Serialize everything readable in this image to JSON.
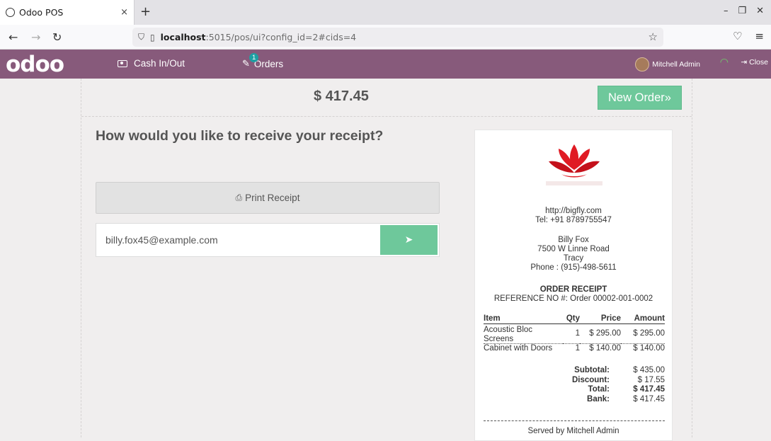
{
  "browser": {
    "tab_title": "Odoo POS",
    "tab_close": "×",
    "new_tab": "+",
    "url_host": "localhost",
    "url_path": ":5015/pos/ui?config_id=2#cids=4"
  },
  "header": {
    "logo": "odoo",
    "cash_label": "Cash In/Out",
    "orders_label": "Orders",
    "orders_badge": "1",
    "user_name": "Mitchell Admin",
    "close_label": "Close",
    "brand_color": "#875a7b"
  },
  "main": {
    "total": "$ 417.45",
    "new_order_label": "New Order",
    "question": "How would you like to receive your receipt?",
    "print_label": "Print Receipt",
    "email_value": "billy.fox45@example.com",
    "accent_color": "#6ec89b"
  },
  "receipt": {
    "website": "http://bigfly.com",
    "phone": "Tel: +91 8789755547",
    "customer_name": "Billy Fox",
    "customer_street": "7500 W Linne Road",
    "customer_city": "Tracy",
    "customer_phone": "Phone : (915)-498-5611",
    "title": "ORDER RECEIPT",
    "reference": "REFERENCE NO #: Order 00002-001-0002",
    "columns": [
      "Item",
      "Qty",
      "Price",
      "Amount"
    ],
    "lines": [
      {
        "item": "Acoustic Bloc Screens",
        "qty": "1",
        "price": "$ 295.00",
        "amount": "$ 295.00"
      },
      {
        "item": "Cabinet with Doors",
        "qty": "1",
        "price": "$ 140.00",
        "amount": "$ 140.00"
      }
    ],
    "subtotal_label": "Subtotal:",
    "subtotal": "$ 435.00",
    "discount_label": "Discount:",
    "discount": "$ 17.55",
    "total_label": "Total:",
    "total": "$ 417.45",
    "bank_label": "Bank:",
    "bank": "$ 417.45",
    "served_by": "Served by Mitchell Admin"
  }
}
